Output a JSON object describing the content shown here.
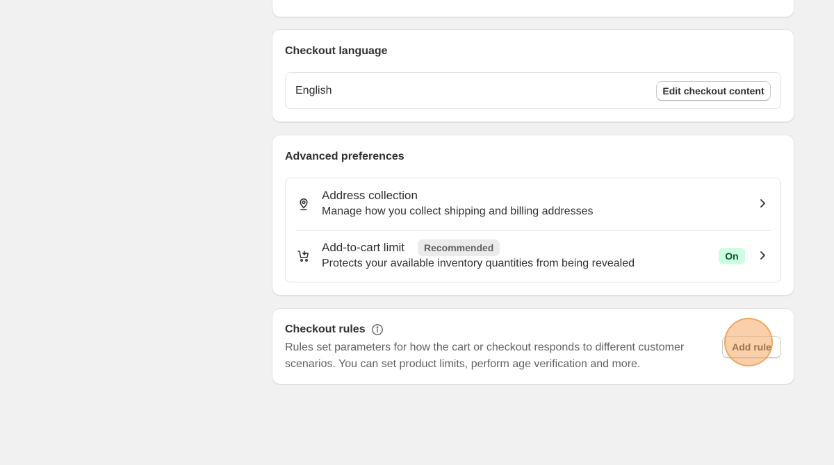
{
  "checkout_language": {
    "title": "Checkout language",
    "language_value": "English",
    "edit_button_label": "Edit checkout content"
  },
  "advanced_preferences": {
    "title": "Advanced preferences",
    "items": [
      {
        "icon": "location-pin-icon",
        "title": "Address collection",
        "subtitle": "Manage how you collect shipping and billing addresses"
      },
      {
        "icon": "cart-limit-icon",
        "title": "Add-to-cart limit",
        "badge": "Recommended",
        "subtitle": "Protects your available inventory quantities from being revealed",
        "status": "On"
      }
    ]
  },
  "checkout_rules": {
    "title": "Checkout rules",
    "description": "Rules set parameters for how the cart or checkout responds to different customer scenarios. You can set product limits, perform age verification and more.",
    "add_button_label": "Add rule"
  },
  "colors": {
    "page_background": "#f1f1f1",
    "card_background": "#ffffff",
    "badge_on_background": "#cdfee1",
    "badge_on_text": "#0c5132",
    "badge_recommended_background": "#ebebeb",
    "click_marker": "#f5aa64"
  }
}
